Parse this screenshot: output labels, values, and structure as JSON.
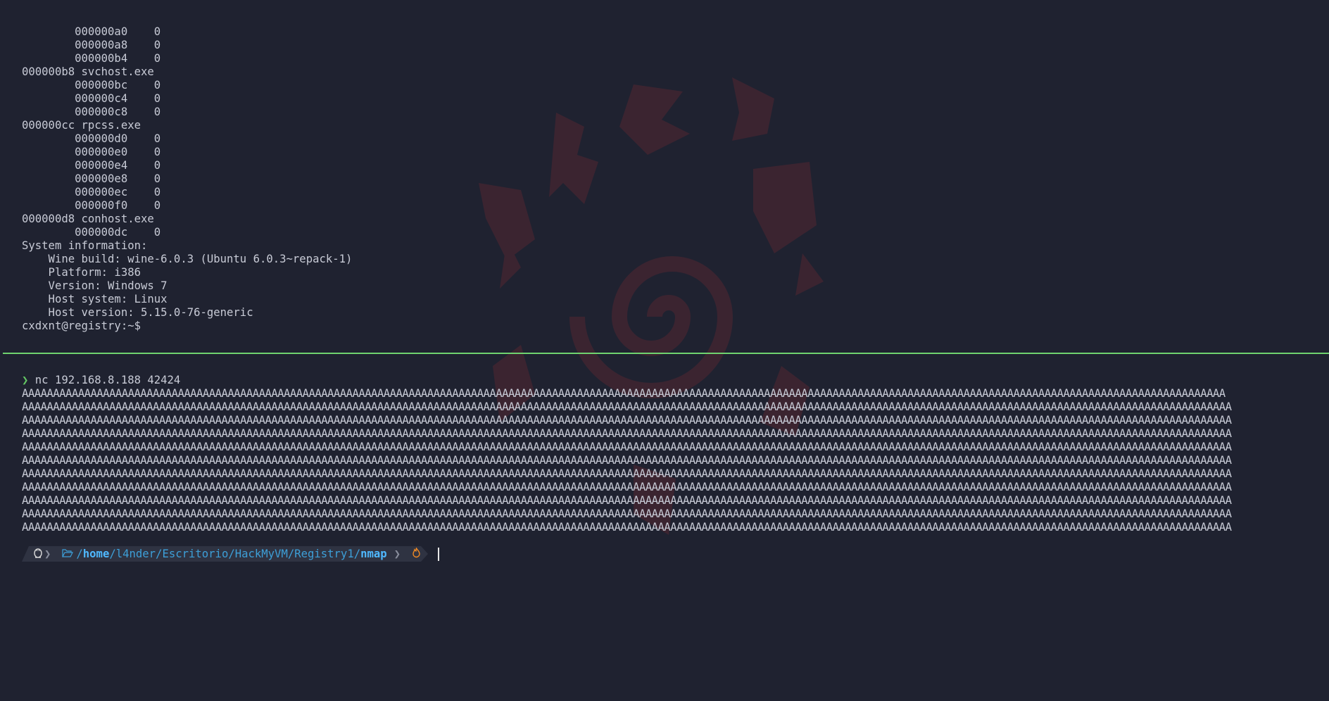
{
  "top_terminal": {
    "lines": [
      "        000000a0    0",
      "        000000a8    0",
      "        000000b4    0",
      "000000b8 svchost.exe",
      "        000000bc    0",
      "        000000c4    0",
      "        000000c8    0",
      "000000cc rpcss.exe",
      "        000000d0    0",
      "        000000e0    0",
      "        000000e4    0",
      "        000000e8    0",
      "        000000ec    0",
      "        000000f0    0",
      "000000d8 conhost.exe",
      "        000000dc    0",
      "System information:",
      "    Wine build: wine-6.0.3 (Ubuntu 6.0.3~repack-1)",
      "    Platform: i386",
      "    Version: Windows 7",
      "    Host system: Linux",
      "    Host version: 5.15.0-76-generic",
      "cxdxnt@registry:~$"
    ]
  },
  "bottom_terminal": {
    "prompt_symbol": "❯",
    "command": "nc 192.168.8.188 42424",
    "payload_lines": [
      "AAAAAAAAAAAAAAAAAAAAAAAAAAAAAAAAAAAAAAAAAAAAAAAAAAAAAAAAAAAAAAAAAAAAAAAAAAAAAAAAAAAAAAAAAAAAAAAAAAAAAAAAAAAAAAAAAAAAAAAAAAAAAAAAAAAAAAAAAAAAAAAAAAAAAAAAAAAAAAAAAAAAAAAAAAAAAAAAAAAAAAAAAAAAAAAAA",
      "AAAAAAAAAAAAAAAAAAAAAAAAAAAAAAAAAAAAAAAAAAAAAAAAAAAAAAAAAAAAAAAAAAAAAAAAAAAAAAAAAAAAAAAAAAAAAAAAAAAAAAAAAAAAAAAAAAAAAAAAAAAAAAAAAAAAAAAAAAAAAAAAAAAAAAAAAAAAAAAAAAAAAAAAAAAAAAAAAAAAAAAAAAAAAAAAAA",
      "AAAAAAAAAAAAAAAAAAAAAAAAAAAAAAAAAAAAAAAAAAAAAAAAAAAAAAAAAAAAAAAAAAAAAAAAAAAAAAAAAAAAAAAAAAAAAAAAAAAAAAAAAAAAAAAAAAAAAAAAAAAAAAAAAAAAAAAAAAAAAAAAAAAAAAAAAAAAAAAAAAAAAAAAAAAAAAAAAAAAAAAAAAAAAAAAAA",
      "AAAAAAAAAAAAAAAAAAAAAAAAAAAAAAAAAAAAAAAAAAAAAAAAAAAAAAAAAAAAAAAAAAAAAAAAAAAAAAAAAAAAAAAAAAAAAAAAAAAAAAAAAAAAAAAAAAAAAAAAAAAAAAAAAAAAAAAAAAAAAAAAAAAAAAAAAAAAAAAAAAAAAAAAAAAAAAAAAAAAAAAAAAAAAAAAAA",
      "AAAAAAAAAAAAAAAAAAAAAAAAAAAAAAAAAAAAAAAAAAAAAAAAAAAAAAAAAAAAAAAAAAAAAAAAAAAAAAAAAAAAAAAAAAAAAAAAAAAAAAAAAAAAAAAAAAAAAAAAAAAAAAAAAAAAAAAAAAAAAAAAAAAAAAAAAAAAAAAAAAAAAAAAAAAAAAAAAAAAAAAAAAAAAAAAAA",
      "AAAAAAAAAAAAAAAAAAAAAAAAAAAAAAAAAAAAAAAAAAAAAAAAAAAAAAAAAAAAAAAAAAAAAAAAAAAAAAAAAAAAAAAAAAAAAAAAAAAAAAAAAAAAAAAAAAAAAAAAAAAAAAAAAAAAAAAAAAAAAAAAAAAAAAAAAAAAAAAAAAAAAAAAAAAAAAAAAAAAAAAAAAAAAAAAAA",
      "AAAAAAAAAAAAAAAAAAAAAAAAAAAAAAAAAAAAAAAAAAAAAAAAAAAAAAAAAAAAAAAAAAAAAAAAAAAAAAAAAAAAAAAAAAAAAAAAAAAAAAAAAAAAAAAAAAAAAAAAAAAAAAAAAAAAAAAAAAAAAAAAAAAAAAAAAAAAAAAAAAAAAAAAAAAAAAAAAAAAAAAAAAAAAAAAAA",
      "AAAAAAAAAAAAAAAAAAAAAAAAAAAAAAAAAAAAAAAAAAAAAAAAAAAAAAAAAAAAAAAAAAAAAAAAAAAAAAAAAAAAAAAAAAAAAAAAAAAAAAAAAAAAAAAAAAAAAAAAAAAAAAAAAAAAAAAAAAAAAAAAAAAAAAAAAAAAAAAAAAAAAAAAAAAAAAAAAAAAAAAAAAAAAAAAAA",
      "AAAAAAAAAAAAAAAAAAAAAAAAAAAAAAAAAAAAAAAAAAAAAAAAAAAAAAAAAAAAAAAAAAAAAAAAAAAAAAAAAAAAAAAAAAAAAAAAAAAAAAAAAAAAAAAAAAAAAAAAAAAAAAAAAAAAAAAAAAAAAAAAAAAAAAAAAAAAAAAAAAAAAAAAAAAAAAAAAAAAAAAAAAAAAAAAAA",
      "AAAAAAAAAAAAAAAAAAAAAAAAAAAAAAAAAAAAAAAAAAAAAAAAAAAAAAAAAAAAAAAAAAAAAAAAAAAAAAAAAAAAAAAAAAAAAAAAAAAAAAAAAAAAAAAAAAAAAAAAAAAAAAAAAAAAAAAAAAAAAAAAAAAAAAAAAAAAAAAAAAAAAAAAAAAAAAAAAAAAAAAAAAAAAAAAAA",
      "AAAAAAAAAAAAAAAAAAAAAAAAAAAAAAAAAAAAAAAAAAAAAAAAAAAAAAAAAAAAAAAAAAAAAAAAAAAAAAAAAAAAAAAAAAAAAAAAAAAAAAAAAAAAAAAAAAAAAAAAAAAAAAAAAAAAAAAAAAAAAAAAAAAAAAAAAAAAAAAAAAAAAAAAAAAAAAAAAAAAAAAAAAAAAAAAAA",
      "AAAAAAAAAAAAAAAAAAAAAAAAAAAAAAAAAAAAAAAAAAAAAAAAAAAAAAAAAAAAAAAAAAAAAAAAAAAAAAAAAAAAAAAAAAAAAAAAAAAAAAAAAAAAAAAAAAAAAAAAAAAAAAAAAAAAAAAAAAAAAAAAAAAAAAAAAAAAAAAAAAAAAAAAAAAAAAAAAAAAAAAAAAAA"
    ],
    "prompt_bar": {
      "os_icon": "linux-tux-icon",
      "folder_icon": "folder-open-icon",
      "path_prefix": "/",
      "path_home": "home",
      "path_middle": "/l4nder/Escritorio/HackMyVM/Registry1/",
      "path_current": "nmap",
      "status_icon": "flame-icon"
    }
  },
  "colors": {
    "background": "#1f2230",
    "text": "#c8cbd6",
    "divider": "#6fd36f",
    "path": "#3d9fd8",
    "flame": "#f08a24",
    "watermark": "#5a2a36"
  }
}
